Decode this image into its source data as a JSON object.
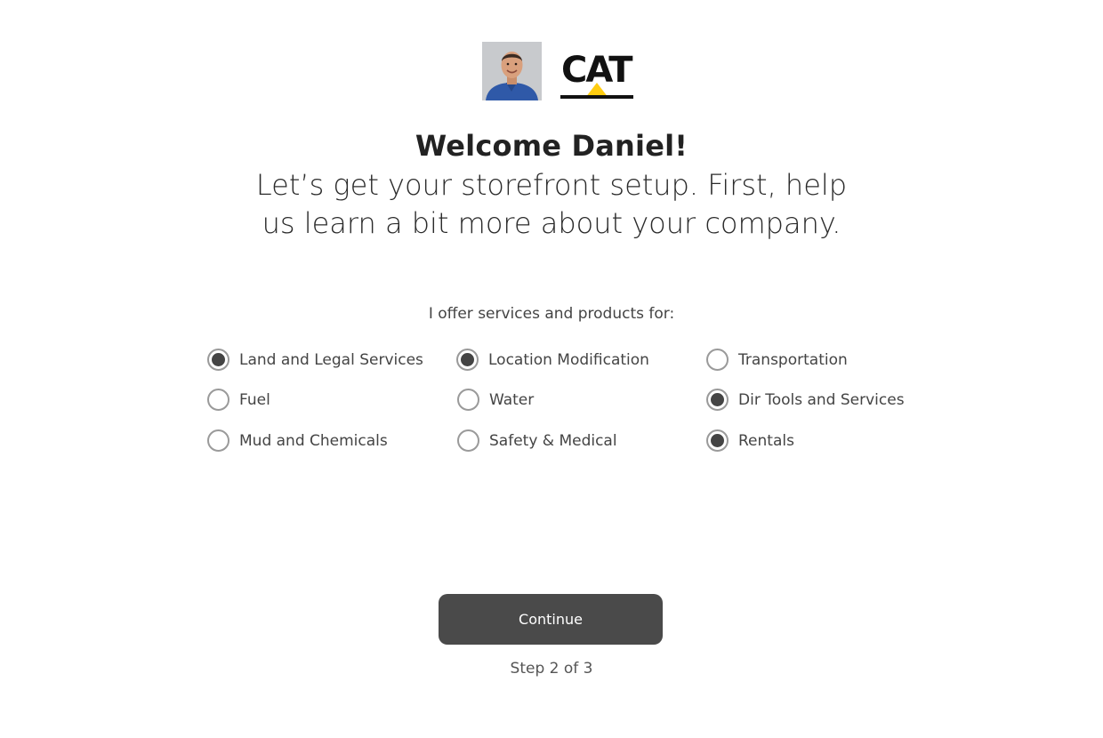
{
  "header": {
    "welcome": "Welcome Daniel!",
    "subtitle_line1": "Let’s get your storefront setup. First, help",
    "subtitle_line2": "us learn a bit more about your company."
  },
  "logos": {
    "avatar": "user-avatar-photo",
    "brand": "CAT"
  },
  "form": {
    "prompt": "I offer services and products for:",
    "options": [
      {
        "label": "Land and Legal Services",
        "selected": true
      },
      {
        "label": "Location Modification",
        "selected": true
      },
      {
        "label": "Transportation",
        "selected": false
      },
      {
        "label": "Fuel",
        "selected": false
      },
      {
        "label": "Water",
        "selected": false
      },
      {
        "label": "Dir Tools and Services",
        "selected": true
      },
      {
        "label": "Mud and Chemicals",
        "selected": false
      },
      {
        "label": "Safety & Medical",
        "selected": false
      },
      {
        "label": "Rentals",
        "selected": true
      }
    ]
  },
  "footer": {
    "continue_label": "Continue",
    "step_text": "Step 2 of 3"
  },
  "colors": {
    "button_bg": "#4a4a4a",
    "radio_selected": "#444444",
    "radio_border": "#9a9a9a",
    "cat_yellow": "#FFCD11"
  }
}
